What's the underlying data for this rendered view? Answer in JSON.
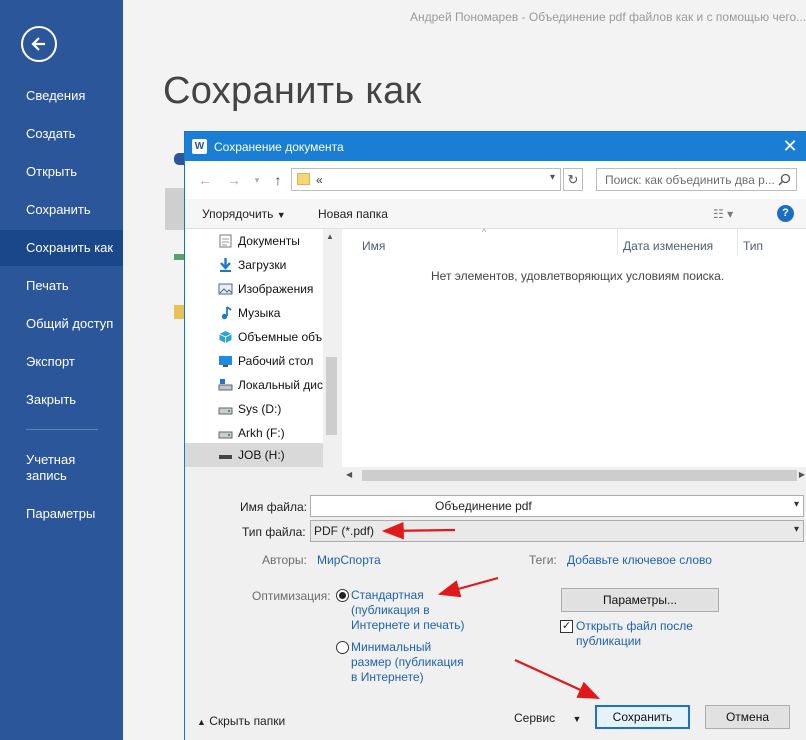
{
  "window_title": "Андрей Пономарев - Объединение pdf файлов как и с помощью чего...",
  "backstage": {
    "items": [
      {
        "label": "Сведения"
      },
      {
        "label": "Создать"
      },
      {
        "label": "Открыть"
      },
      {
        "label": "Сохранить"
      },
      {
        "label": "Сохранить как"
      },
      {
        "label": "Печать"
      },
      {
        "label": "Общий доступ"
      },
      {
        "label": "Экспорт"
      },
      {
        "label": "Закрыть"
      },
      {
        "label": "Учетная\nзапись"
      },
      {
        "label": "Параметры"
      }
    ],
    "active_item": "Сохранить как"
  },
  "page_title": "Сохранить как",
  "dialog": {
    "title": "Сохранение документа",
    "title_icon_letter": "W",
    "address": "«",
    "search_placeholder": "Поиск: как объединить два р...",
    "toolbar": {
      "organize": "Упорядочить",
      "new_folder": "Новая папка"
    },
    "tree": [
      {
        "label": "Документы",
        "icon": "documents-icon"
      },
      {
        "label": "Загрузки",
        "icon": "downloads-icon"
      },
      {
        "label": "Изображения",
        "icon": "pictures-icon"
      },
      {
        "label": "Музыка",
        "icon": "music-icon"
      },
      {
        "label": "Объемные объ",
        "icon": "3d-objects-icon"
      },
      {
        "label": "Рабочий стол",
        "icon": "desktop-icon"
      },
      {
        "label": "Локальный дис",
        "icon": "local-disk-icon"
      },
      {
        "label": "Sys (D:)",
        "icon": "drive-icon"
      },
      {
        "label": "Arkh (F:)",
        "icon": "drive-icon"
      },
      {
        "label": "JOB (H:)",
        "icon": "drive-icon"
      }
    ],
    "columns": {
      "name": "Имя",
      "date": "Дата изменения",
      "type": "Тип"
    },
    "empty_message": "Нет элементов, удовлетворяющих условиям поиска.",
    "filename_label": "Имя файла:",
    "filename_value": "Объединение pdf",
    "filetype_label": "Тип файла:",
    "filetype_value": "PDF (*.pdf)",
    "authors_label": "Авторы:",
    "authors_value": "МирСпорта",
    "tags_label": "Теги:",
    "tags_value": "Добавьте ключевое слово",
    "optimization_label": "Оптимизация:",
    "opt_standard": [
      "Стандартная",
      "(публикация в",
      "Интернете и печать)"
    ],
    "opt_minimal": [
      "Минимальный",
      "размер (публикация",
      "в Интернете)"
    ],
    "opt_selected": "standard",
    "params_button": "Параметры...",
    "open_after_label": [
      "Открыть файл после",
      "публикации"
    ],
    "open_after_checked": true,
    "hide_folders": "Скрыть папки",
    "service": "Сервис",
    "save_button": "Сохранить",
    "cancel_button": "Отмена"
  },
  "colors": {
    "backstage": "#2b579a",
    "backstage_active": "#19478a",
    "titlebar": "#1a7fd4",
    "link": "#1d62b3",
    "annotation_arrow": "#e0191b"
  }
}
